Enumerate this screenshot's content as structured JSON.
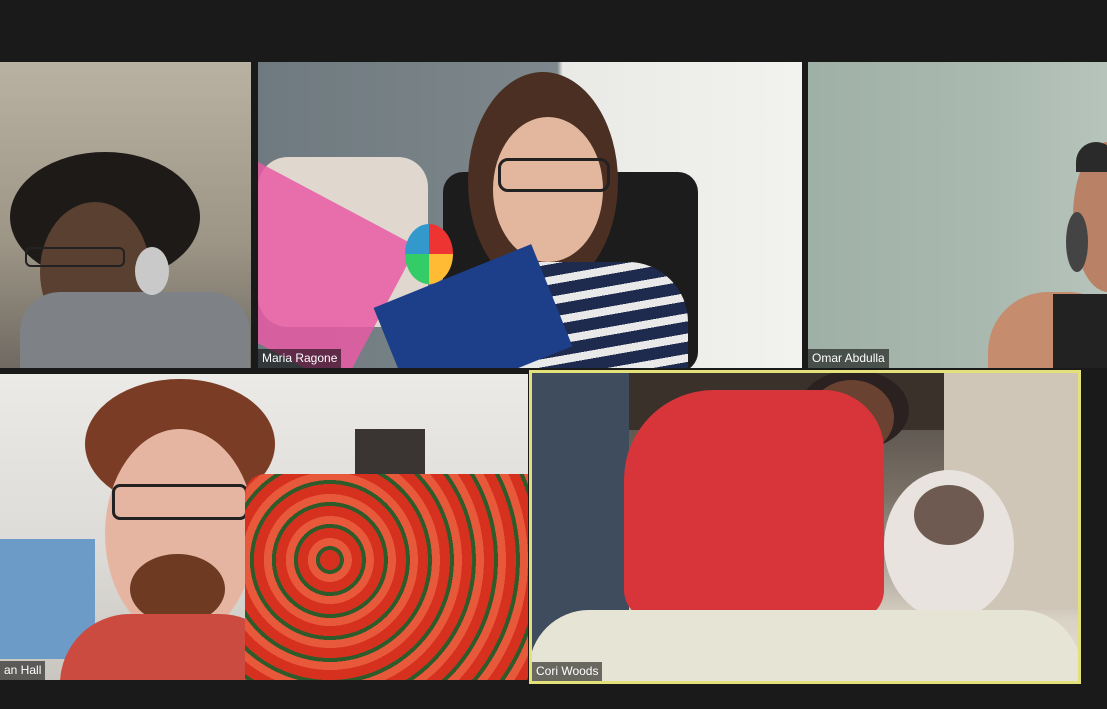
{
  "participants": [
    {
      "name": ""
    },
    {
      "name": "Maria Ragone"
    },
    {
      "name": "Omar Abdulla"
    },
    {
      "name": "an Hall"
    },
    {
      "name": "Cori Woods",
      "active_speaker": true
    }
  ],
  "colors": {
    "background": "#1a1a1a",
    "active_speaker_border": "#e5e17a",
    "name_tag_text": "#ffffff"
  }
}
